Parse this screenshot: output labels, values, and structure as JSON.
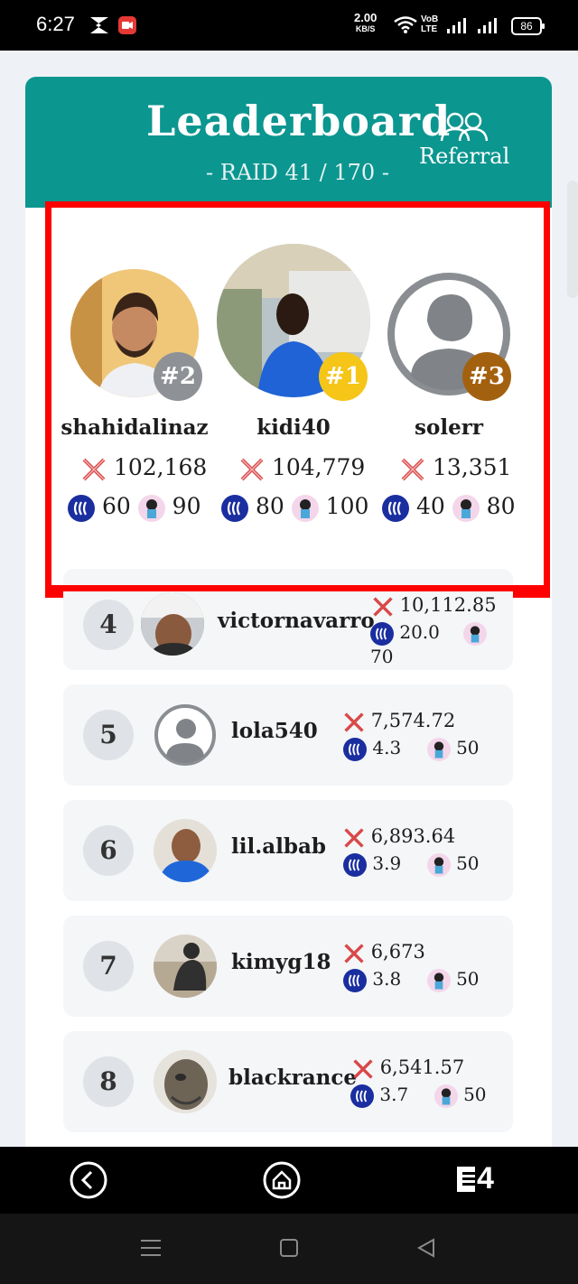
{
  "status_bar": {
    "time": "6:27",
    "net_speed_value": "2.00",
    "net_speed_unit": "KB/S",
    "volte_top": "VoB",
    "volte_bottom": "LTE",
    "battery": "86"
  },
  "header": {
    "title": "Leaderboard",
    "subtitle": "- RAID 41 / 170 -",
    "referral_label": "Referral"
  },
  "podium": [
    {
      "rank": "#2",
      "name": "shahidalinaz",
      "score": "102,168",
      "steem": "60",
      "mini": "90",
      "badge_color": "#8e9196"
    },
    {
      "rank": "#1",
      "name": "kidi40",
      "score": "104,779",
      "steem": "80",
      "mini": "100",
      "badge_color": "#f5c518"
    },
    {
      "rank": "#3",
      "name": "solerr",
      "score": "13,351",
      "steem": "40",
      "mini": "80",
      "badge_color": "#a3610f"
    }
  ],
  "rows": [
    {
      "rank": "4",
      "name": "victornavarro",
      "score": "10,112.85",
      "steem": "20.0",
      "mini": "70"
    },
    {
      "rank": "5",
      "name": "lola540",
      "score": "7,574.72",
      "steem": "4.3",
      "mini": "50"
    },
    {
      "rank": "6",
      "name": "lil.albab",
      "score": "6,893.64",
      "steem": "3.9",
      "mini": "50"
    },
    {
      "rank": "7",
      "name": "kimyg18",
      "score": "6,673",
      "steem": "3.8",
      "mini": "50"
    },
    {
      "rank": "8",
      "name": "blackrance",
      "score": "6,541.57",
      "steem": "3.7",
      "mini": "50"
    }
  ],
  "bottom_nav": {
    "back_icon": "back-icon",
    "home_icon": "home-icon",
    "logo_text": "4"
  },
  "colors": {
    "header_teal": "#0c9690",
    "highlight_red": "#ff0000",
    "steem_blue": "#1a2ea0"
  }
}
